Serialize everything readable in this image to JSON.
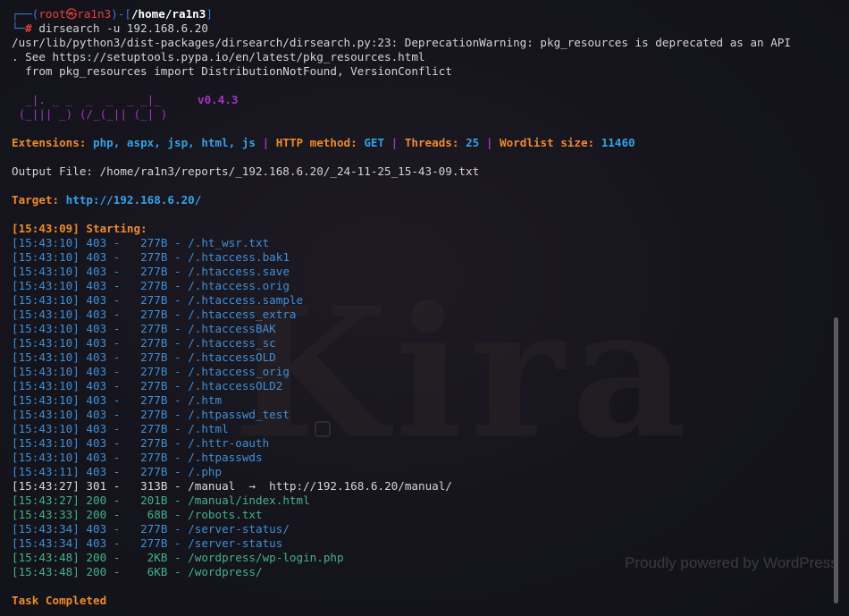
{
  "prompt": {
    "corner_top": "┌──(",
    "user": "root㉿ra1n3",
    "mid": ")-[",
    "path": "/home/ra1n3",
    "end": "]",
    "corner_bottom": "└─",
    "hash": "#",
    "command": " dirsearch -u 192.168.6.20"
  },
  "warning": [
    "/usr/lib/python3/dist-packages/dirsearch/dirsearch.py:23: DeprecationWarning: pkg_resources is deprecated as an API",
    ". See https://setuptools.pypa.io/en/latest/pkg_resources.html",
    "  from pkg_resources import DistributionNotFound, VersionConflict"
  ],
  "banner": {
    "line1": "  _|. _ _  _  _  _ _|_    ",
    "line2": " (_||| _) (/_(_|| (_| )   ",
    "version": "v0.4.3"
  },
  "config": {
    "ext_label": "Extensions: ",
    "ext_value": "php, aspx, jsp, html, js",
    "sep": " | ",
    "method_label": "HTTP method: ",
    "method_value": "GET",
    "threads_label": "Threads: ",
    "threads_value": "25",
    "wordlist_label": "Wordlist size: ",
    "wordlist_value": "11460"
  },
  "output_file": "Output File: /home/ra1n3/reports/_192.168.6.20/_24-11-25_15-43-09.txt",
  "target": {
    "label": "Target: ",
    "url": "http://192.168.6.20/"
  },
  "starting": "[15:43:09] Starting: ",
  "results": [
    {
      "ts": "[15:43:10]",
      "code": "403",
      "size": "277B",
      "path": "/.ht_wsr.txt",
      "redirect": ""
    },
    {
      "ts": "[15:43:10]",
      "code": "403",
      "size": "277B",
      "path": "/.htaccess.bak1",
      "redirect": ""
    },
    {
      "ts": "[15:43:10]",
      "code": "403",
      "size": "277B",
      "path": "/.htaccess.save",
      "redirect": ""
    },
    {
      "ts": "[15:43:10]",
      "code": "403",
      "size": "277B",
      "path": "/.htaccess.orig",
      "redirect": ""
    },
    {
      "ts": "[15:43:10]",
      "code": "403",
      "size": "277B",
      "path": "/.htaccess.sample",
      "redirect": ""
    },
    {
      "ts": "[15:43:10]",
      "code": "403",
      "size": "277B",
      "path": "/.htaccess_extra",
      "redirect": ""
    },
    {
      "ts": "[15:43:10]",
      "code": "403",
      "size": "277B",
      "path": "/.htaccessBAK",
      "redirect": ""
    },
    {
      "ts": "[15:43:10]",
      "code": "403",
      "size": "277B",
      "path": "/.htaccess_sc",
      "redirect": ""
    },
    {
      "ts": "[15:43:10]",
      "code": "403",
      "size": "277B",
      "path": "/.htaccessOLD",
      "redirect": ""
    },
    {
      "ts": "[15:43:10]",
      "code": "403",
      "size": "277B",
      "path": "/.htaccess_orig",
      "redirect": ""
    },
    {
      "ts": "[15:43:10]",
      "code": "403",
      "size": "277B",
      "path": "/.htaccessOLD2",
      "redirect": ""
    },
    {
      "ts": "[15:43:10]",
      "code": "403",
      "size": "277B",
      "path": "/.htm",
      "redirect": ""
    },
    {
      "ts": "[15:43:10]",
      "code": "403",
      "size": "277B",
      "path": "/.htpasswd_test",
      "redirect": ""
    },
    {
      "ts": "[15:43:10]",
      "code": "403",
      "size": "277B",
      "path": "/.html",
      "redirect": ""
    },
    {
      "ts": "[15:43:10]",
      "code": "403",
      "size": "277B",
      "path": "/.httr-oauth",
      "redirect": ""
    },
    {
      "ts": "[15:43:10]",
      "code": "403",
      "size": "277B",
      "path": "/.htpasswds",
      "redirect": ""
    },
    {
      "ts": "[15:43:11]",
      "code": "403",
      "size": "277B",
      "path": "/.php",
      "redirect": ""
    },
    {
      "ts": "[15:43:27]",
      "code": "301",
      "size": "313B",
      "path": "/manual",
      "redirect": "  →  http://192.168.6.20/manual/"
    },
    {
      "ts": "[15:43:27]",
      "code": "200",
      "size": "201B",
      "path": "/manual/index.html",
      "redirect": ""
    },
    {
      "ts": "[15:43:33]",
      "code": "200",
      "size": "68B",
      "path": "/robots.txt",
      "redirect": ""
    },
    {
      "ts": "[15:43:34]",
      "code": "403",
      "size": "277B",
      "path": "/server-status/",
      "redirect": ""
    },
    {
      "ts": "[15:43:34]",
      "code": "403",
      "size": "277B",
      "path": "/server-status",
      "redirect": ""
    },
    {
      "ts": "[15:43:48]",
      "code": "200",
      "size": "2KB",
      "path": "/wordpress/wp-login.php",
      "redirect": ""
    },
    {
      "ts": "[15:43:48]",
      "code": "200",
      "size": "6KB",
      "path": "/wordpress/",
      "redirect": ""
    }
  ],
  "task_completed": "Task Completed",
  "background": {
    "watermark": "Kira",
    "powered": "Proudly powered by WordPress"
  }
}
